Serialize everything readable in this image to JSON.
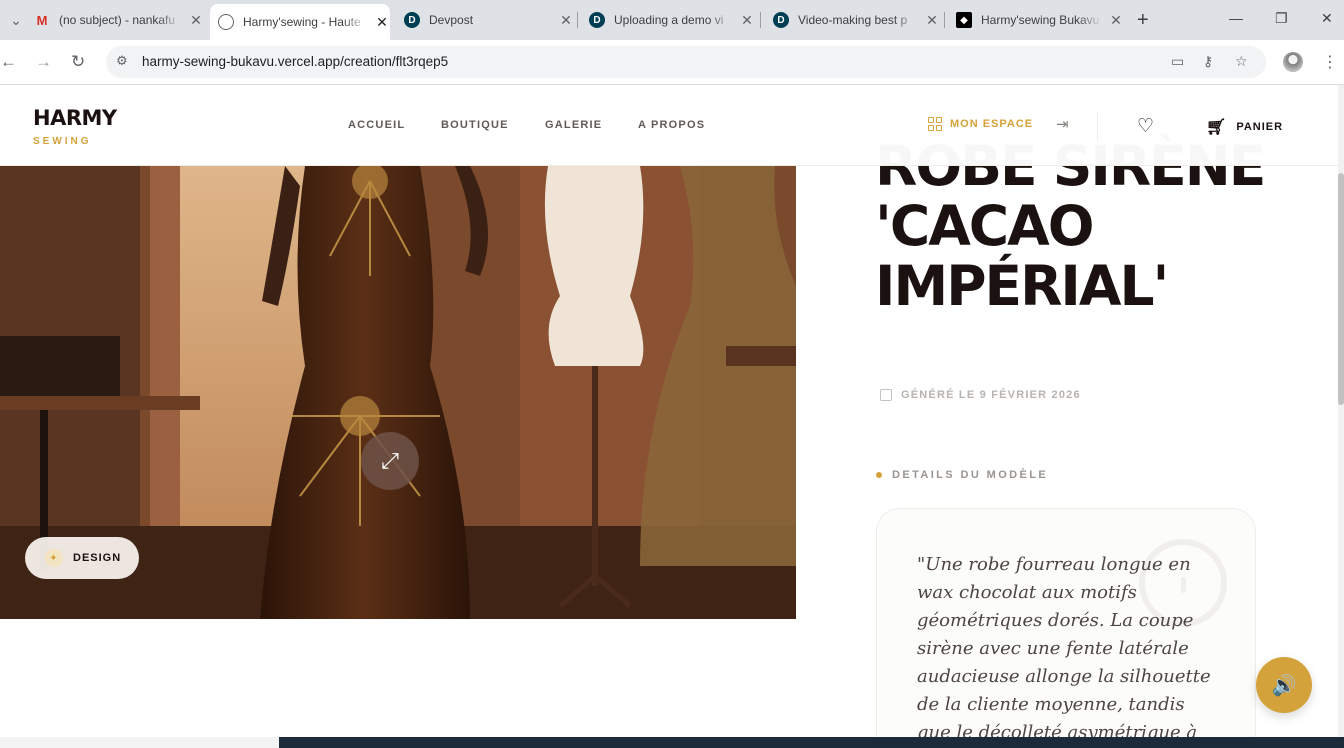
{
  "browser": {
    "tabs": [
      {
        "title": "(no subject) - nankafu",
        "icon": "gmail-icon"
      },
      {
        "title": "Harmy'sewing - Haute",
        "icon": "globe-icon"
      },
      {
        "title": "Devpost",
        "icon": "devpost-icon"
      },
      {
        "title": "Uploading a demo vi",
        "icon": "devpost-icon"
      },
      {
        "title": "Video-making best p",
        "icon": "devpost-icon"
      },
      {
        "title": "Harmy'sewing Bukavu",
        "icon": "github-icon"
      }
    ],
    "active_tab_index": 1,
    "url": "harmy-sewing-bukavu.vercel.app/creation/flt3rqep5"
  },
  "site": {
    "logo": {
      "main": "HARMY",
      "sub": "SEWING"
    },
    "nav": [
      "ACCUEIL",
      "BOUTIQUE",
      "GALERIE",
      "A PROPOS"
    ],
    "mon_espace": "MON ESPACE",
    "cart": "PANIER"
  },
  "creation": {
    "title": "ROBE SIRÈNE 'CACAO IMPÉRIAL'",
    "generated": "GÉNÉRÉ LE 9 FÉVRIER 2026",
    "design_badge": "DESIGN",
    "details_label": "DETAILS DU MODÈLE",
    "quote": "\"Une robe fourreau longue en wax chocolat aux motifs géométriques dorés. La coupe sirène avec une fente latérale audacieuse allonge la silhouette de la cliente moyenne, tandis que le décolleté asymétrique à une"
  },
  "colors": {
    "accent": "#d4a23a",
    "ink": "#1a1110",
    "muted": "#9a948f"
  }
}
